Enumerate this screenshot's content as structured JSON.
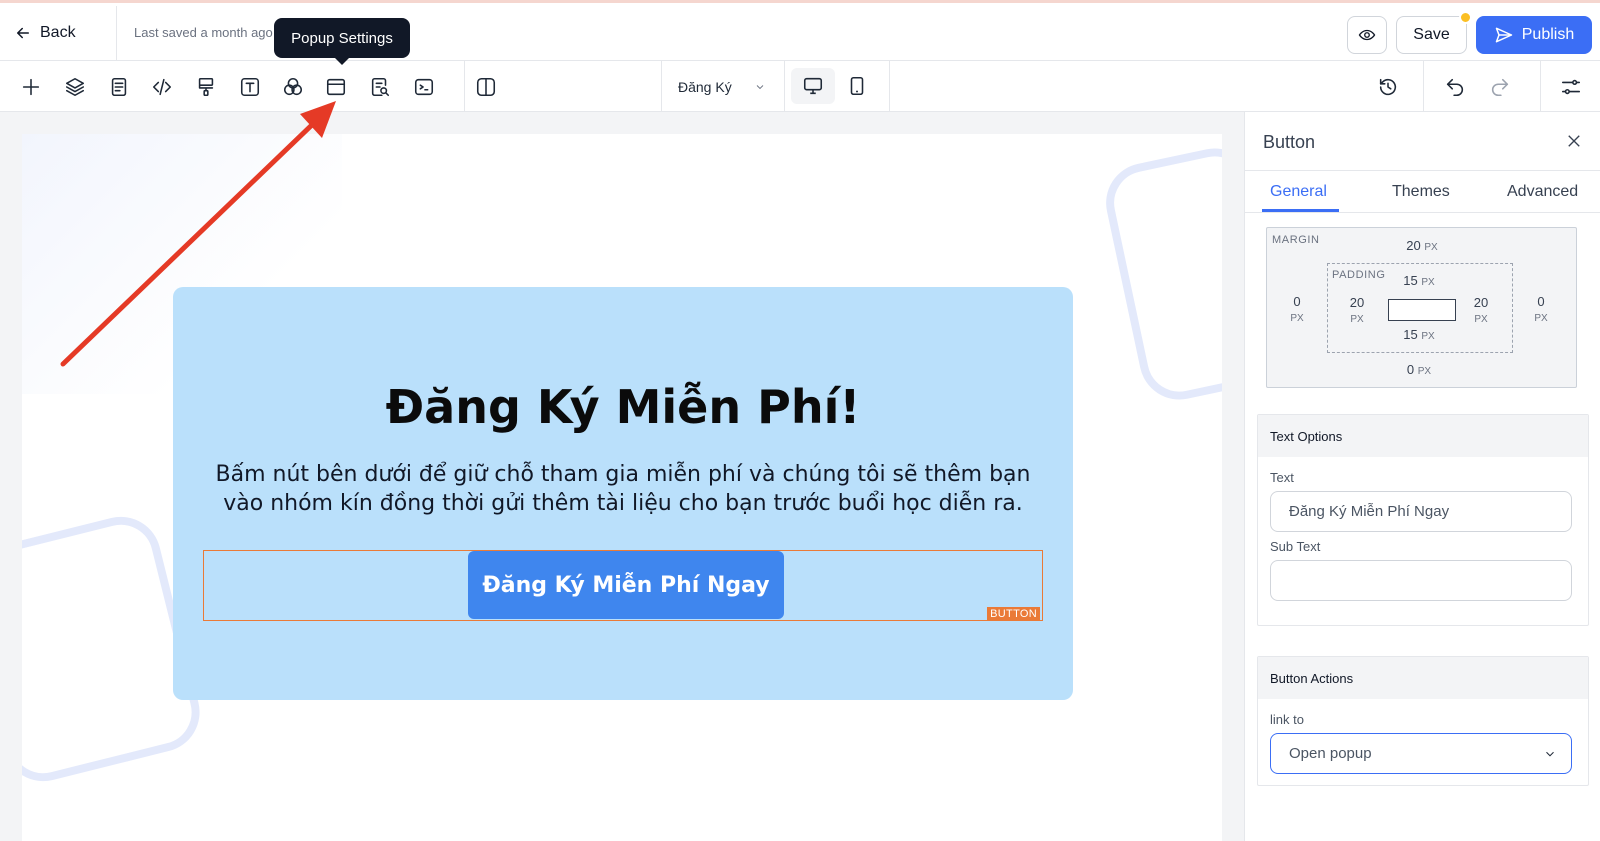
{
  "header": {
    "back_label": "Back",
    "saved_status": "Last saved a month ago",
    "tooltip": "Popup Settings",
    "save_label": "Save",
    "publish_label": "Publish"
  },
  "toolbar": {
    "tools": [
      "plus-icon",
      "layers-icon",
      "page-icon",
      "code-icon",
      "paint-roller-icon",
      "text-icon",
      "color-circles-icon",
      "popup-icon",
      "search-doc-icon",
      "terminal-icon",
      "split-view-icon"
    ],
    "page_select": "Đăng Ký",
    "devices": [
      "desktop-icon",
      "tablet-icon"
    ],
    "right_tools": [
      "history-icon",
      "undo-icon",
      "redo-icon",
      "settings-sliders-icon"
    ]
  },
  "canvas": {
    "popup_title": "Đăng Ký Miễn Phí!",
    "popup_description": "Bấm nút bên dưới để giữ chỗ tham gia miễn phí và chúng tôi sẽ thêm bạn vào nhóm kín đồng thời gửi thêm tài liệu cho bạn trước buổi học diễn ra.",
    "cta_label": "Đăng Ký Miễn Phí Ngay",
    "element_tag": "BUTTON",
    "colors": {
      "popup_bg": "#bae0fb",
      "cta_bg": "#3f86ee",
      "selection": "#ea7a37"
    }
  },
  "panel": {
    "title": "Button",
    "tabs": [
      "General",
      "Themes",
      "Advanced"
    ],
    "active_tab": "General",
    "spacing": {
      "margin_label": "MARGIN",
      "padding_label": "PADDING",
      "unit": "PX",
      "margin_top": "20",
      "margin_left": "0",
      "margin_right": "0",
      "margin_bottom": "0",
      "padding_top": "15",
      "padding_left": "20",
      "padding_right": "20",
      "padding_bottom": "15"
    },
    "text_options": {
      "heading": "Text Options",
      "text_label": "Text",
      "text_value": "Đăng Ký Miễn Phí Ngay",
      "subtext_label": "Sub Text",
      "subtext_value": ""
    },
    "button_actions": {
      "heading": "Button Actions",
      "link_label": "link to",
      "link_value": "Open popup"
    },
    "accent_color": "#3b6ef5"
  }
}
